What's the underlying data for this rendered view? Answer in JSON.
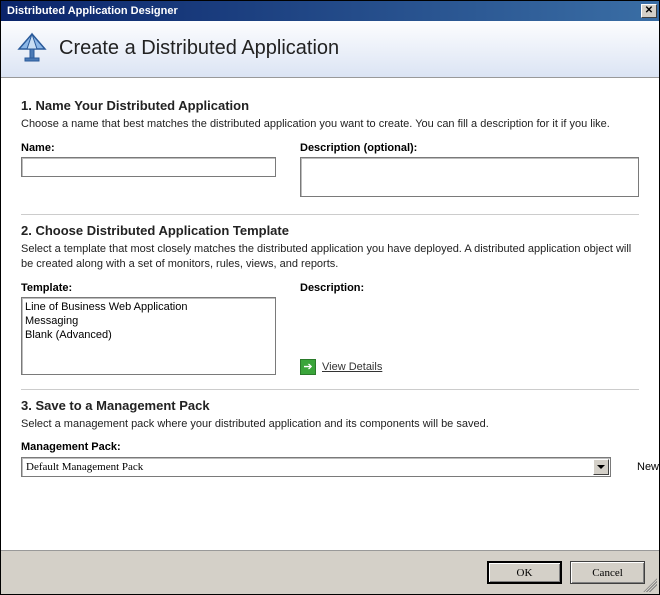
{
  "window": {
    "title": "Distributed Application Designer",
    "header_title": "Create a Distributed Application"
  },
  "section1": {
    "heading": "1. Name Your Distributed Application",
    "desc": "Choose a name that best matches the distributed application you want to create. You can fill a description for it if you like.",
    "name_label": "Name:",
    "name_value": "",
    "desc_label": "Description (optional):",
    "desc_value": ""
  },
  "section2": {
    "heading": "2. Choose Distributed Application Template",
    "desc": "Select a template that most closely matches the distributed application you have deployed. A distributed application object will be created along with a set of monitors, rules, views, and reports.",
    "template_label": "Template:",
    "desc_label": "Description:",
    "templates": [
      "Line of Business Web Application",
      "Messaging",
      "Blank (Advanced)"
    ],
    "view_details": "View Details"
  },
  "section3": {
    "heading": "3. Save to a Management Pack",
    "desc": "Select a management pack where your distributed application and its components will be saved.",
    "mp_label": "Management Pack:",
    "mp_selected": "Default Management Pack",
    "new_label": "New..."
  },
  "buttons": {
    "ok": "OK",
    "cancel": "Cancel"
  }
}
